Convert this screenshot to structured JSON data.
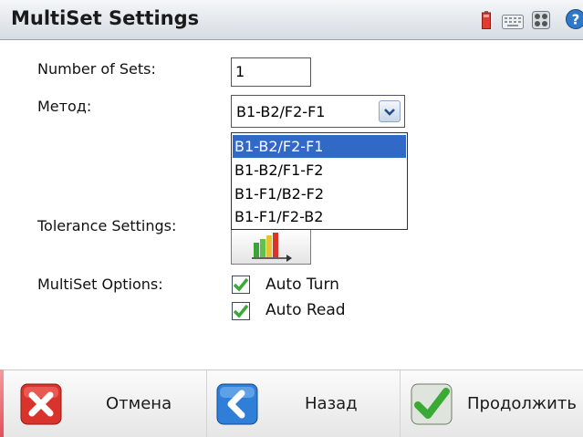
{
  "window": {
    "title": "MultiSet Settings",
    "tray_icons": [
      "battery-icon",
      "keyboard-icon",
      "network-icon",
      "help-icon"
    ]
  },
  "form": {
    "sets_label": "Number of Sets:",
    "sets_value": "1",
    "method_label": "Метод:",
    "method_value": "B1-B2/F2-F1",
    "method_options": [
      "B1-B2/F2-F1",
      "B1-B2/F1-F2",
      "B1-F1/B2-F2",
      "B1-F1/F2-B2"
    ],
    "tolerance_label": "Tolerance Settings:",
    "options_label": "MultiSet Options:",
    "auto_turn_label": "Auto Turn",
    "auto_turn_checked": true,
    "auto_read_label": "Auto Read",
    "auto_read_checked": true
  },
  "footer": {
    "cancel_label": "Отмена",
    "back_label": "Назад",
    "continue_label": "Продолжить"
  },
  "colors": {
    "selection": "#3169c6",
    "check_green": "#3aaa35",
    "cancel_red": "#d9342b",
    "back_blue": "#2f7fd8"
  }
}
